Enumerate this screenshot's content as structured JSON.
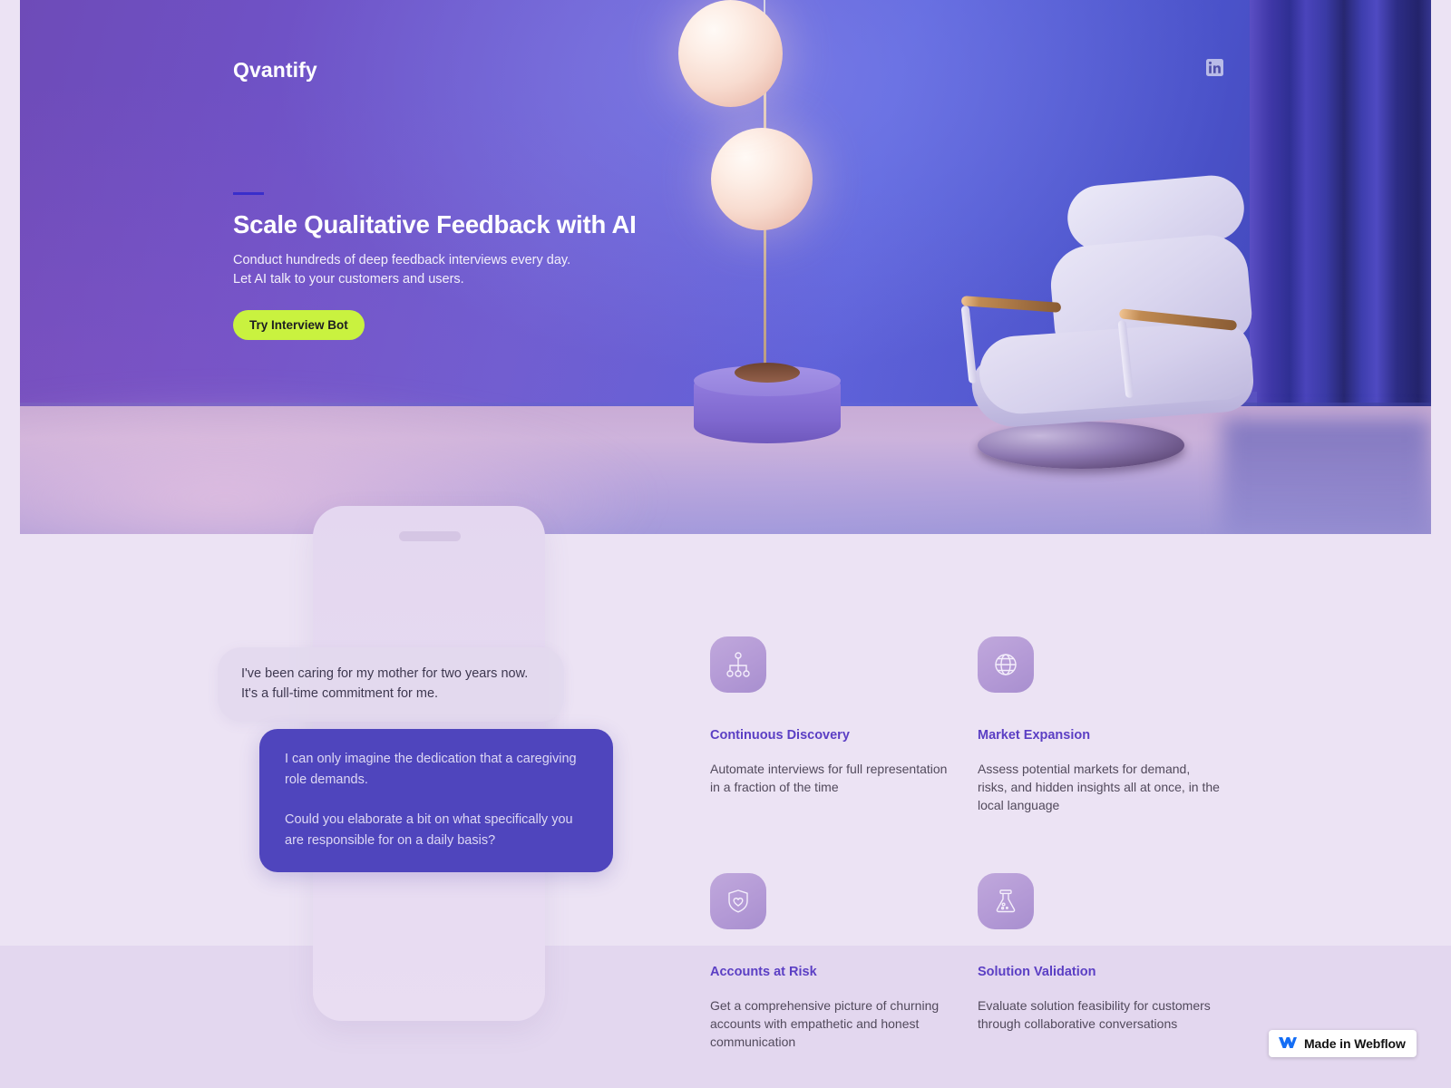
{
  "brand": {
    "logo": "Qvantify",
    "accent_lime": "#c9f23f",
    "accent_purple": "#5b3fc4",
    "hero_gradient_from": "#6e4bb8",
    "hero_gradient_to": "#3b3aa8",
    "page_background": "#ece3f4"
  },
  "nav": {
    "linkedin_label": "in",
    "linkedin_icon": "linkedin-icon"
  },
  "hero": {
    "title": "Scale Qualitative Feedback with AI",
    "subtitle_line1": "Conduct hundreds of deep feedback interviews every day.",
    "subtitle_line2": "Let AI talk to your customers and users.",
    "cta_label": "Try Interview Bot"
  },
  "conversation": {
    "user_message": "I've been caring for my mother for two years now. It's a full-time commitment for me.",
    "bot_message_1": "I can only imagine the dedication that a caregiving role demands.",
    "bot_message_2": "Could you elaborate a bit on what specifically you are responsible for on a daily basis?"
  },
  "features": [
    {
      "icon": "org-chart-icon",
      "title": "Continuous Discovery",
      "description": "Automate interviews for full representation in a fraction of the time"
    },
    {
      "icon": "globe-icon",
      "title": "Market Expansion",
      "description": "Assess potential markets for demand, risks, and hidden insights all at once, in the local language"
    },
    {
      "icon": "shield-heart-icon",
      "title": "Accounts at Risk",
      "description": "Get a comprehensive picture of churning accounts with empathetic and honest communication"
    },
    {
      "icon": "flask-icon",
      "title": "Solution Validation",
      "description": "Evaluate solution feasibility for customers through collaborative conversations"
    }
  ],
  "badge": {
    "label": "Made in Webflow",
    "icon": "webflow-logo-icon"
  }
}
